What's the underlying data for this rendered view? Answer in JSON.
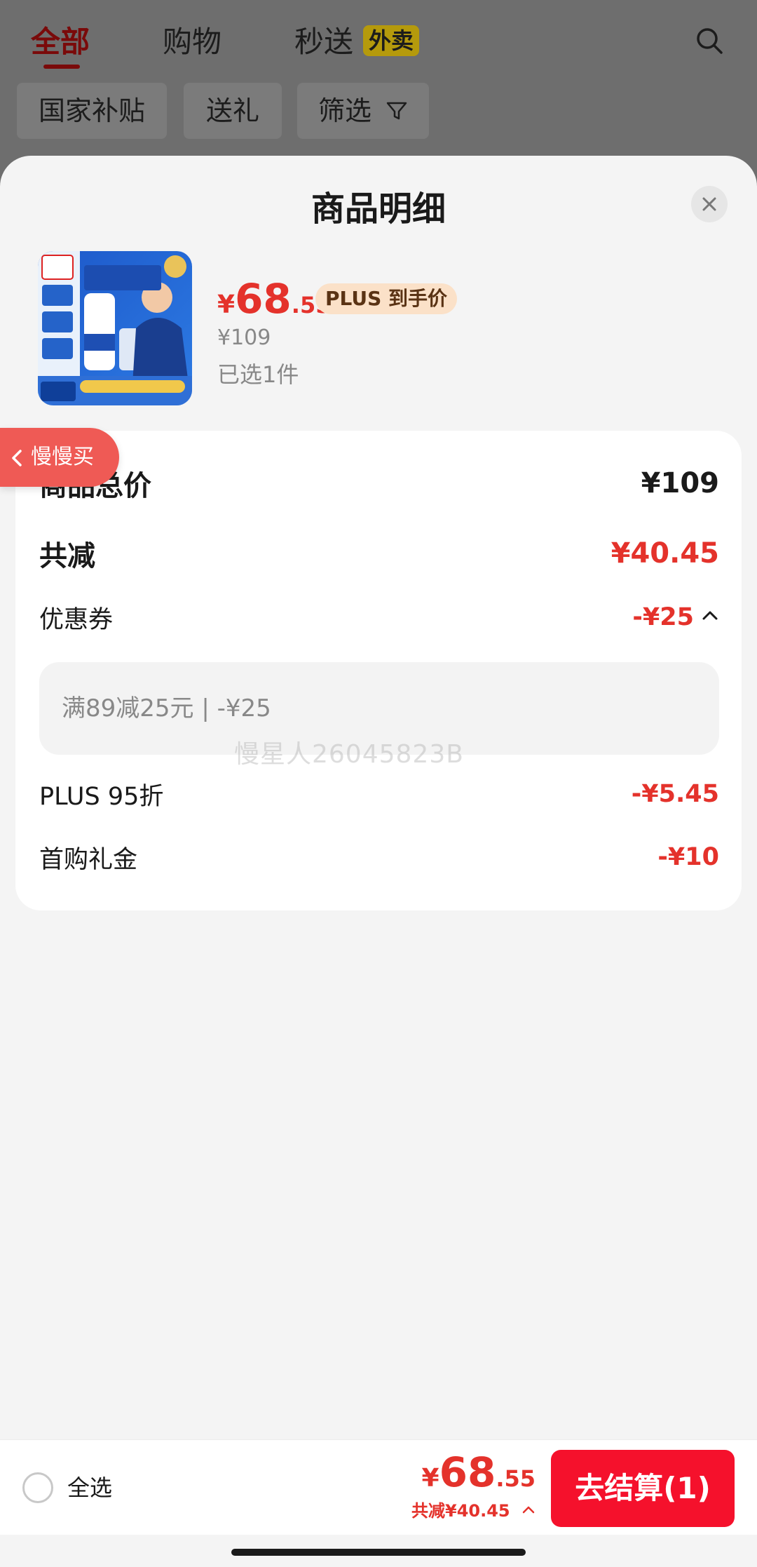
{
  "background_nav": {
    "tabs": [
      {
        "label": "全部"
      },
      {
        "label": "购物"
      },
      {
        "label": "秒送"
      }
    ],
    "badge": "外卖",
    "chips": [
      {
        "label": "国家补贴"
      },
      {
        "label": "送礼"
      },
      {
        "label": "筛选"
      }
    ]
  },
  "sheet": {
    "title": "商品明细",
    "product": {
      "price_symbol": "¥",
      "price_int": "68",
      "price_dec": ".55",
      "plus_tag": "PLUS 到手价",
      "original_price": "¥109",
      "selected_count": "已选1件"
    },
    "breakdown": {
      "total_label": "商品总价",
      "total_value": "¥109",
      "reduce_label": "共减",
      "reduce_value": "¥40.45",
      "coupon_label": "优惠券",
      "coupon_value": "-¥25",
      "coupon_detail": "满89减25元 | -¥25",
      "plus_label": "PLUS 95折",
      "plus_value": "-¥5.45",
      "gift_label": "首购礼金",
      "gift_value": "-¥10"
    },
    "watermark": "慢星人26045823B",
    "slow_buy": "慢慢买"
  },
  "bottom_bar": {
    "select_all": "全选",
    "price_symbol": "¥",
    "price_int": "68",
    "price_dec": ".55",
    "saved": "共减¥40.45",
    "checkout": "去结算(1)"
  },
  "colors": {
    "accent": "#e4322b",
    "checkout": "#f5112c",
    "plus_tag_bg": "#fbe1c8"
  }
}
